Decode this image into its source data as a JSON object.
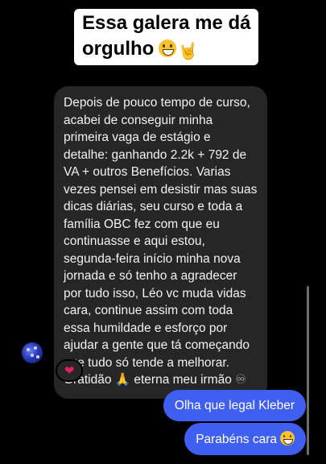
{
  "caption": {
    "line1": "Essa galera me dá",
    "line2": "orgulho",
    "hand_emoji": "🤘"
  },
  "received_message": {
    "text": "Depois de pouco tempo de curso, acabei de conseguir minha primeira vaga de estágio e detalhe: ganhando 2.2k + 792 de VA + outros Benefícios. Varias vezes pensei em desistir mas suas dicas diárias, seu curso e toda a família OBC fez com que eu continuasse e aqui estou, segunda-feira início minha nova jornada e só tenho a agradecer por tudo isso, Léo vc muda vidas cara, continue assim com toda essa humildade e esforço por ajudar a gente que tá começando que tudo só tende a melhorar. Gratidão",
    "pray_emoji": "🙏",
    "tail": " eterna  meu irmão ",
    "infinity": "♾",
    "reaction": "❤"
  },
  "sent_messages": [
    {
      "text": "Olha que legal Kleber"
    },
    {
      "text": "Parabéns cara"
    }
  ],
  "colors": {
    "background": "#000000",
    "received_bubble": "#262626",
    "sent_bubble": "#3f5ff0"
  }
}
